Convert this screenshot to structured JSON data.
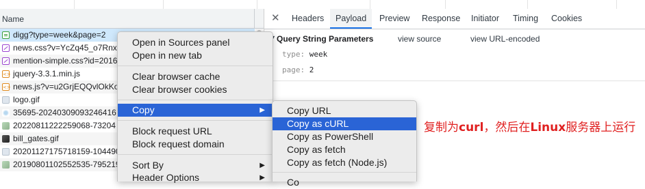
{
  "request_list": {
    "column_header": "Name",
    "rows": [
      {
        "name": "digg?type=week&page=2",
        "icon": "document-icon",
        "selected": true
      },
      {
        "name": "news.css?v=YcZq45_o7Rnx",
        "icon": "stylesheet-icon"
      },
      {
        "name": "mention-simple.css?id=2016",
        "icon": "stylesheet-icon"
      },
      {
        "name": "jquery-3.3.1.min.js",
        "icon": "script-icon"
      },
      {
        "name": "news.js?v=u2GrjEQQvlOkKo",
        "icon": "script-icon"
      },
      {
        "name": "logo.gif",
        "icon": "image-icon"
      },
      {
        "name": "35695-20240309093246416",
        "icon": "image-icon"
      },
      {
        "name": "20220811222259068-73204",
        "icon": "image-icon"
      },
      {
        "name": "bill_gates.gif",
        "icon": "image-icon"
      },
      {
        "name": "20201127175718159-104490",
        "icon": "image-icon"
      },
      {
        "name": "20190801102552535-795219",
        "icon": "image-icon"
      }
    ]
  },
  "detail_panel": {
    "close_symbol": "✕",
    "tabs": [
      "Headers",
      "Payload",
      "Preview",
      "Response",
      "Initiator",
      "Timing",
      "Cookies"
    ],
    "active_tab": "Payload",
    "query_section": {
      "title": "Query String Parameters",
      "view_source": "view source",
      "view_url_encoded": "view URL-encoded",
      "params": [
        {
          "key": "type:",
          "value": "week"
        },
        {
          "key": "page:",
          "value": "2"
        }
      ]
    }
  },
  "context_menu": {
    "items": [
      "Open in Sources panel",
      "Open in new tab",
      "Clear browser cache",
      "Clear browser cookies",
      "Copy",
      "Block request URL",
      "Block request domain",
      "Sort By",
      "Header Options"
    ],
    "highlighted": "Copy",
    "submenu_arrow": "▶"
  },
  "copy_submenu": {
    "items": [
      "Copy URL",
      "Copy as cURL",
      "Copy as PowerShell",
      "Copy as fetch",
      "Copy as fetch (Node.js)",
      "Co"
    ],
    "highlighted": "Copy as cURL"
  },
  "annotation": {
    "part1": "复制为",
    "part2": "curl",
    "part3": "，然后在",
    "part4": "Linux",
    "part5": "服务器上运行",
    "color": "#e02020"
  },
  "colors": {
    "selection_blue": "#2a64d6",
    "selected_row": "#cfe8fc",
    "tab_underline": "#1a73e8"
  }
}
